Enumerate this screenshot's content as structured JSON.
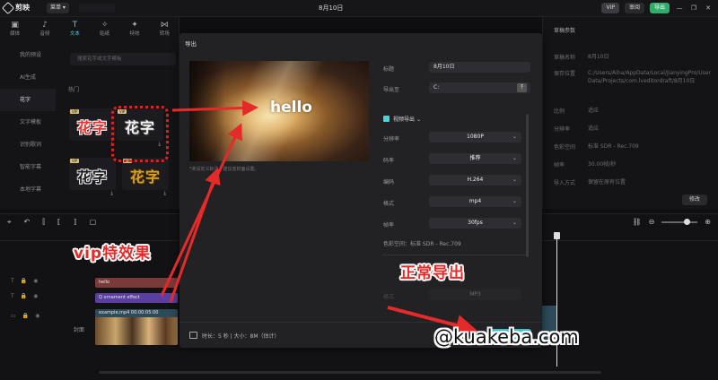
{
  "app": {
    "name": "剪映",
    "menu_label": "菜单 ▾",
    "project_title": "8月10日",
    "vip_label": "VIP",
    "review_label": "审阅",
    "export_label": "导出"
  },
  "left_tabs": [
    {
      "label": "媒体",
      "icon": "media-icon"
    },
    {
      "label": "音频",
      "icon": "audio-icon"
    },
    {
      "label": "文本",
      "icon": "text-icon"
    },
    {
      "label": "贴纸",
      "icon": "sticker-icon"
    },
    {
      "label": "特效",
      "icon": "effects-icon"
    },
    {
      "label": "转场",
      "icon": "transition-icon"
    }
  ],
  "left_categories": [
    "我的预设",
    "AI生成",
    "花字",
    "文字模板",
    "识别歌词",
    "智能字幕",
    "本地字幕"
  ],
  "search_placeholder": "搜索花字或文字模板",
  "section_label": "热门",
  "fx_thumbs": [
    {
      "text": "花字",
      "vip": true
    },
    {
      "text": "花字",
      "vip": true
    },
    {
      "text": "花字",
      "vip": true
    },
    {
      "text": "花字",
      "vip": true
    }
  ],
  "vip_badge": "VIP",
  "right_panel": {
    "title": "草稿参数",
    "rows": [
      {
        "key": "草稿名称",
        "value": "8月10日"
      },
      {
        "key": "保存位置",
        "value": "C:/Users/Aiha/AppData/Local/JianyingPro/User Data/Projects/com.lveditordraft/8月10日"
      },
      {
        "key": "比例",
        "value": "适应"
      },
      {
        "key": "分辨率",
        "value": "适应"
      },
      {
        "key": "色彩空间",
        "value": "标准 SDR - Rec.709"
      },
      {
        "key": "帧率",
        "value": "30.00帧/秒"
      },
      {
        "key": "导入方式",
        "value": "保留在原有位置"
      }
    ],
    "edit_label": "修改"
  },
  "dialog": {
    "title": "导出",
    "preview_text": "hello",
    "preview_note": "*未设定义标注，建议去封面设置。",
    "title_label": "标题",
    "title_value": "8月10日",
    "path_label": "导出至",
    "path_value": "C:",
    "video_export_label": "视频导出",
    "settings": [
      {
        "label": "分辨率",
        "value": "1080P"
      },
      {
        "label": "码率",
        "value": "推荐"
      },
      {
        "label": "编码",
        "value": "H.264"
      },
      {
        "label": "格式",
        "value": "mp4"
      },
      {
        "label": "帧率",
        "value": "30fps"
      }
    ],
    "color_space": "色彩空间：标准 SDR - Rec.709",
    "audio_format_label": "格式",
    "audio_format_value": "MP3",
    "footer_info": "时长：5 秒 | 大小：8M（估计）"
  },
  "timeline": {
    "cover_label": "封面",
    "clips": {
      "text1": "hello",
      "text2": "Q  ornament effect",
      "video": "example.mp4  00:00:05:00"
    }
  },
  "annotations": {
    "vip_effect": "vip特效果",
    "normal_export": "正常导出",
    "watermark": "@kuakeba.com"
  }
}
